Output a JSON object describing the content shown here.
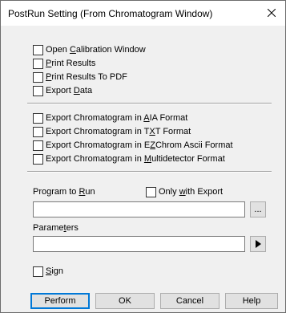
{
  "window": {
    "title": "PostRun Setting (From Chromatogram Window)",
    "close_icon": "close-icon"
  },
  "group1": [
    {
      "pre": "Open ",
      "mn": "C",
      "post": "alibration Window"
    },
    {
      "pre": "",
      "mn": "P",
      "post": "rint Results"
    },
    {
      "pre": "",
      "mn": "P",
      "post": "rint Results To PDF"
    },
    {
      "pre": "Export ",
      "mn": "D",
      "post": "ata"
    }
  ],
  "group2": [
    {
      "pre": "Export Chromatogram in ",
      "mn": "A",
      "post": "IA Format"
    },
    {
      "pre": "Export Chromatogram in T",
      "mn": "X",
      "post": "T Format"
    },
    {
      "pre": "Export Chromatogram in E",
      "mn": "Z",
      "post": "Chrom Ascii Format"
    },
    {
      "pre": "Export Chromatogram in ",
      "mn": "M",
      "post": "ultidetector Format"
    }
  ],
  "program": {
    "label_pre": "Program to ",
    "label_mn": "R",
    "label_post": "un",
    "only_pre": "Only ",
    "only_mn": "w",
    "only_post": "ith Export",
    "browse_label": "...",
    "value": ""
  },
  "parameters": {
    "label_pre": "Parame",
    "label_mn": "t",
    "label_post": "ers",
    "arrow_icon": "play-arrow-icon",
    "value": ""
  },
  "sign": {
    "pre": "",
    "mn": "S",
    "post": "ign"
  },
  "buttons": {
    "perform": "Perform",
    "ok": "OK",
    "cancel": "Cancel",
    "help": "Help"
  }
}
